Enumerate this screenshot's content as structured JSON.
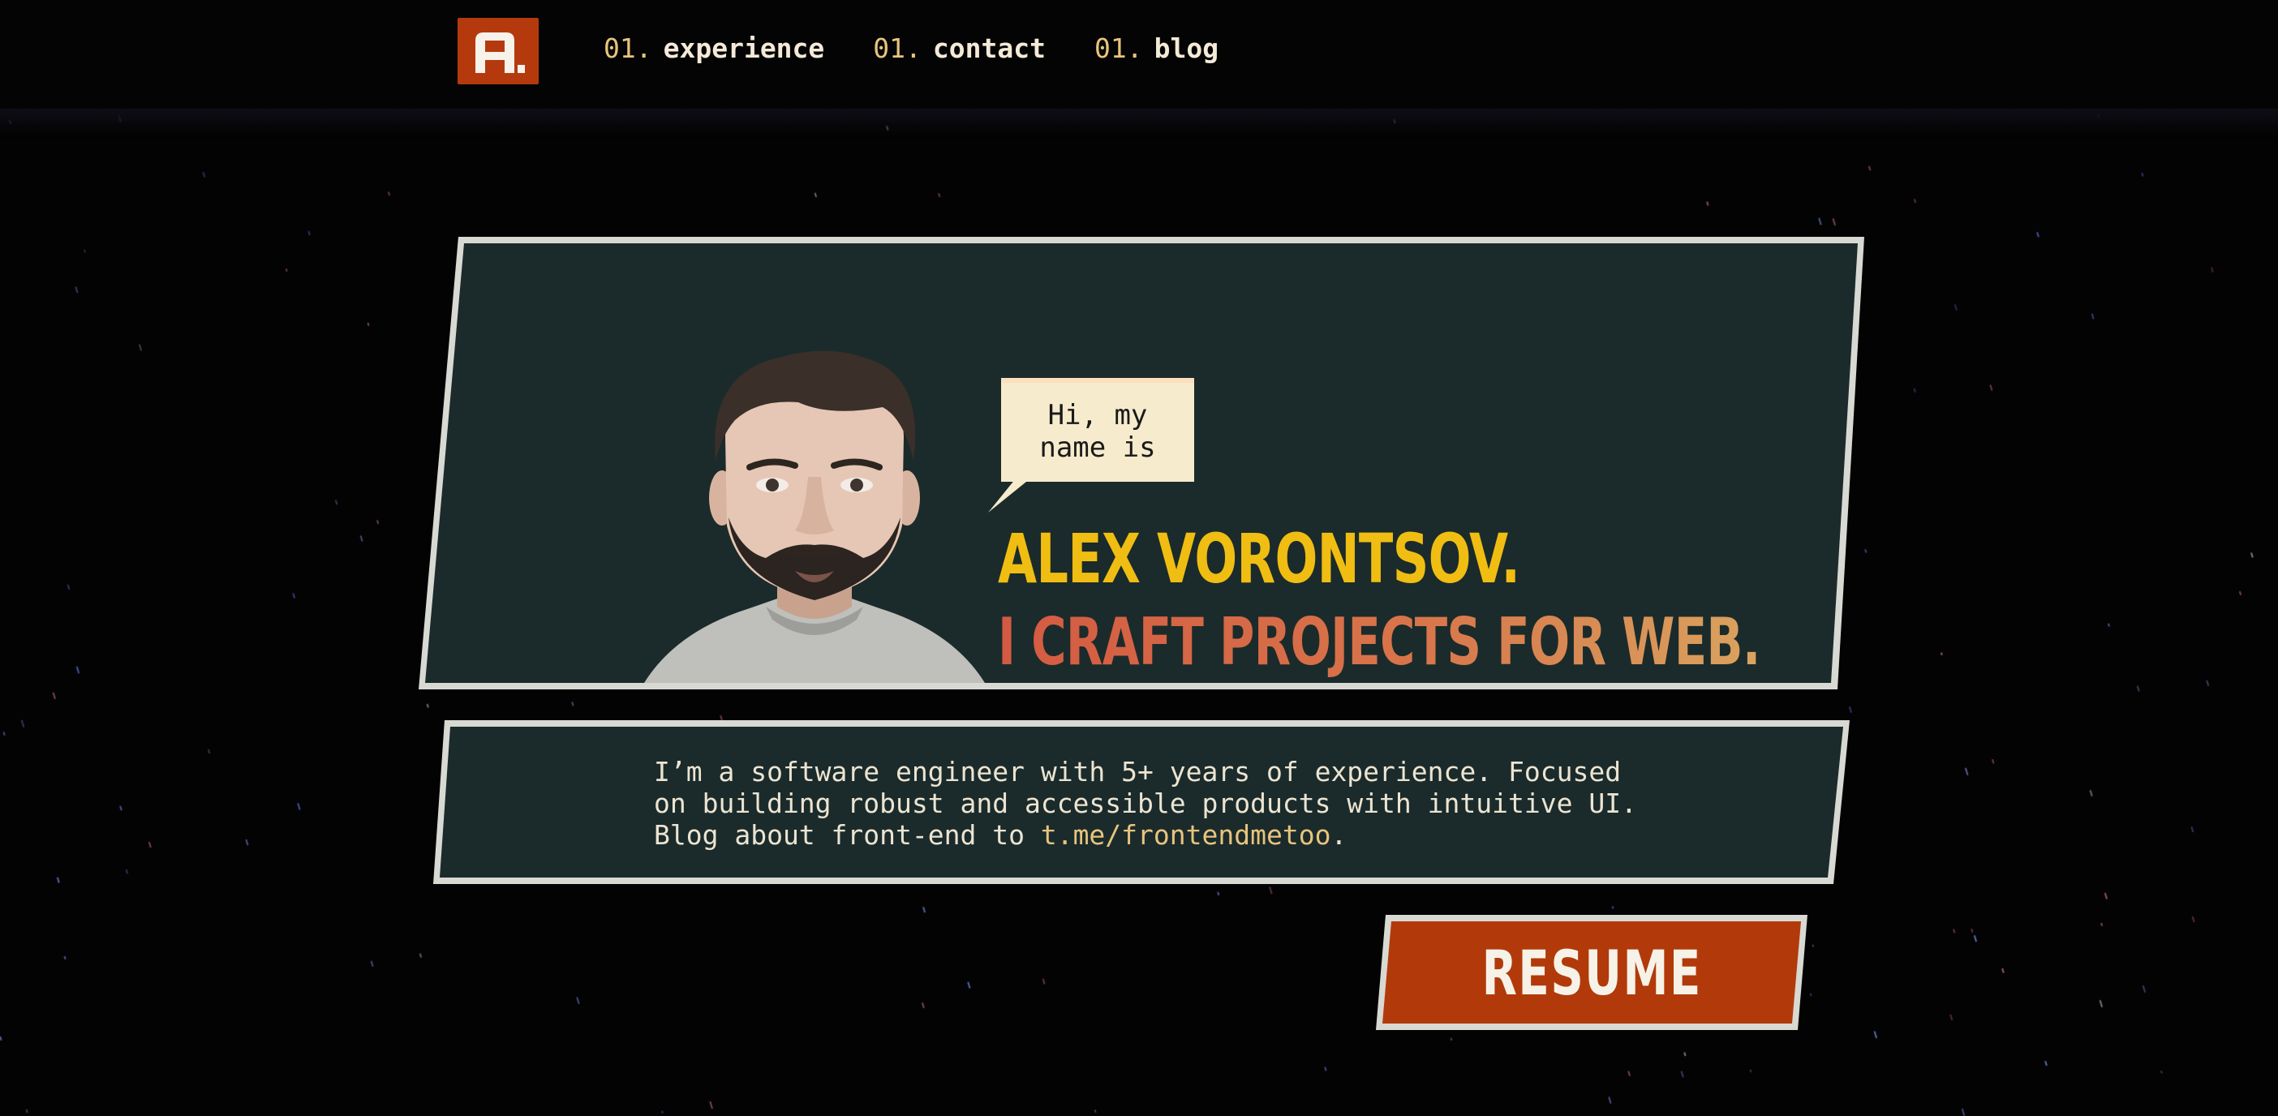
{
  "header": {
    "logo_alt": "A.",
    "nav": [
      {
        "num": "01.",
        "label": "experience"
      },
      {
        "num": "01.",
        "label": "contact"
      },
      {
        "num": "01.",
        "label": "blog"
      }
    ]
  },
  "hero": {
    "speech_bubble": "Hi, my\nname is",
    "name": "ALEX VORONTSOV.",
    "tagline": "I CRAFT PROJECTS FOR WEB."
  },
  "bio": {
    "text_before_link": "I’m a software engineer with 5+ years of experience. Focused\non building robust and accessible products with intuitive UI.\nBlog about front-end to ",
    "link": "t.me/frontendmetoo",
    "text_after_link": "."
  },
  "resume_button": {
    "label": "RESUME"
  },
  "colors": {
    "background": "#030303",
    "panel": "#1b2b2b",
    "panel_border": "#d9d9d4",
    "accent": "#b43a0e",
    "name": "#f0bd12",
    "link": "#e7c47d",
    "bubble": "#f6ebcc"
  },
  "icons": [
    "logo-a-icon",
    "avatar-portrait"
  ]
}
